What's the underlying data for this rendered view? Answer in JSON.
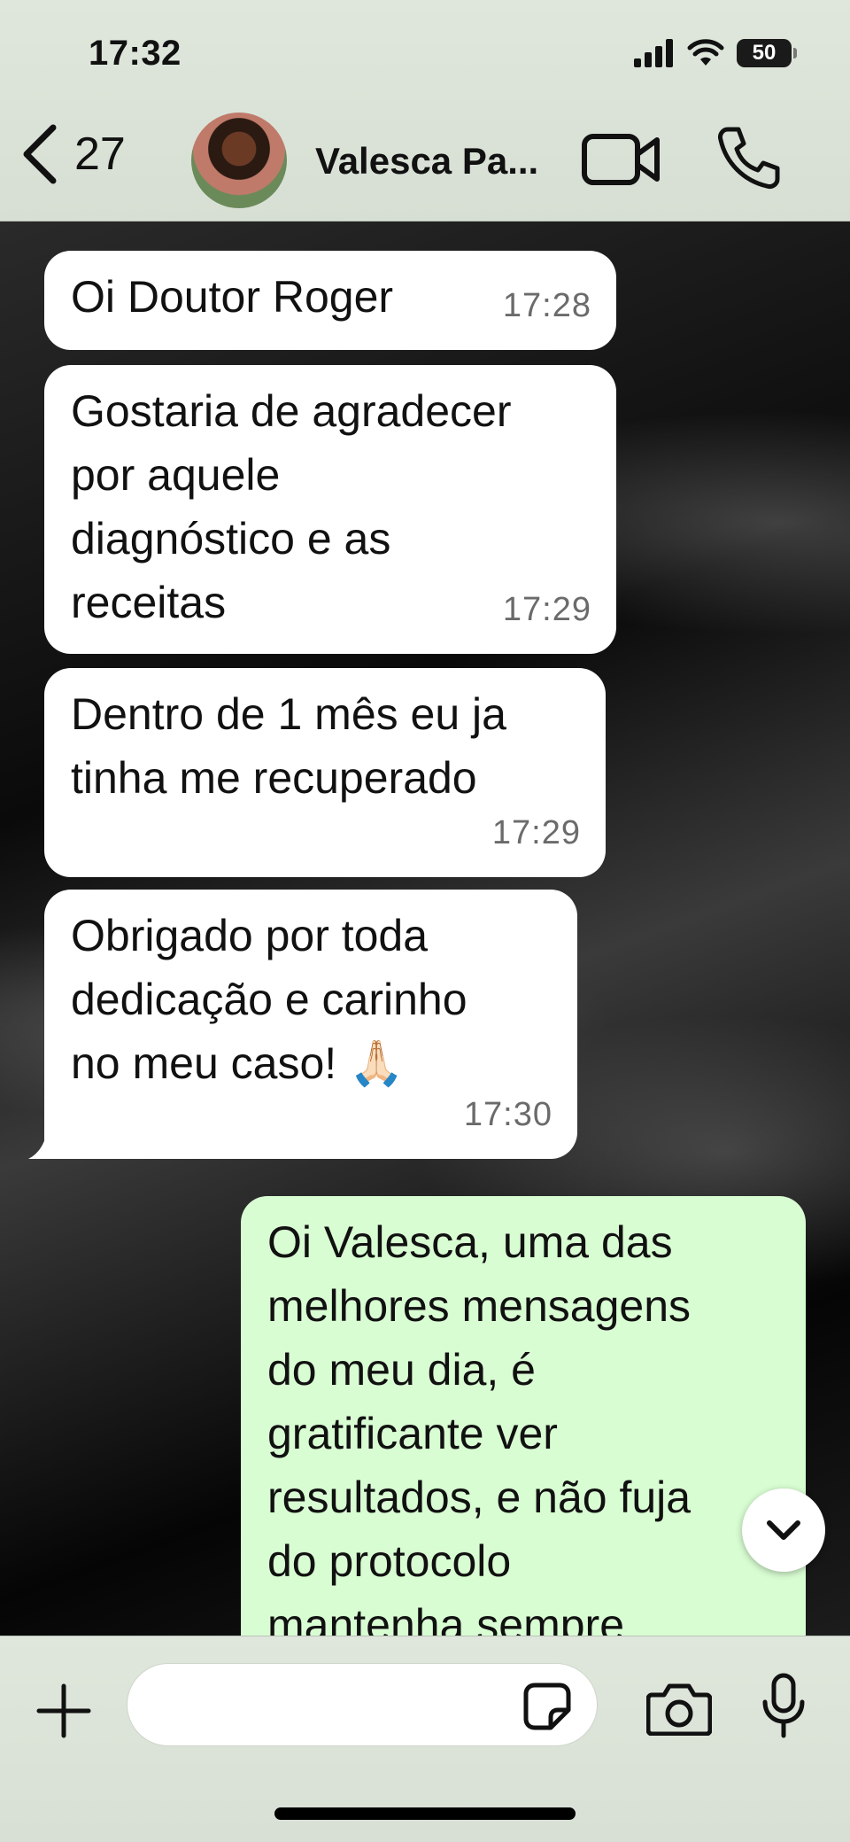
{
  "status_bar": {
    "time": "17:32",
    "battery": "50"
  },
  "header": {
    "back_count": "27",
    "contact_name": "Valesca Pa..."
  },
  "messages": [
    {
      "direction": "incoming",
      "text": "Oi Doutor Roger",
      "time": "17:28"
    },
    {
      "direction": "incoming",
      "text": "Gostaria de agradecer\npor aquele\ndiagnóstico e as\nreceitas",
      "time": "17:29"
    },
    {
      "direction": "incoming",
      "text": "Dentro de 1 mês eu ja\ntinha me recuperado",
      "time": "17:29"
    },
    {
      "direction": "incoming",
      "text": "Obrigado por toda\ndedicação e carinho\nno meu caso! 🙏🏻",
      "time": "17:30"
    },
    {
      "direction": "outgoing",
      "text": "Oi Valesca, uma das\nmelhores mensagens\ndo meu dia, é\ngratificante ver\nresultados, e não fuja\ndo protocolo\nmantenha sempre",
      "time": ""
    }
  ],
  "composer": {
    "input_value": "",
    "input_placeholder": ""
  },
  "colors": {
    "header_bg": "#dfe7dc",
    "incoming_bubble": "#ffffff",
    "outgoing_bubble": "#d9fdd3"
  }
}
